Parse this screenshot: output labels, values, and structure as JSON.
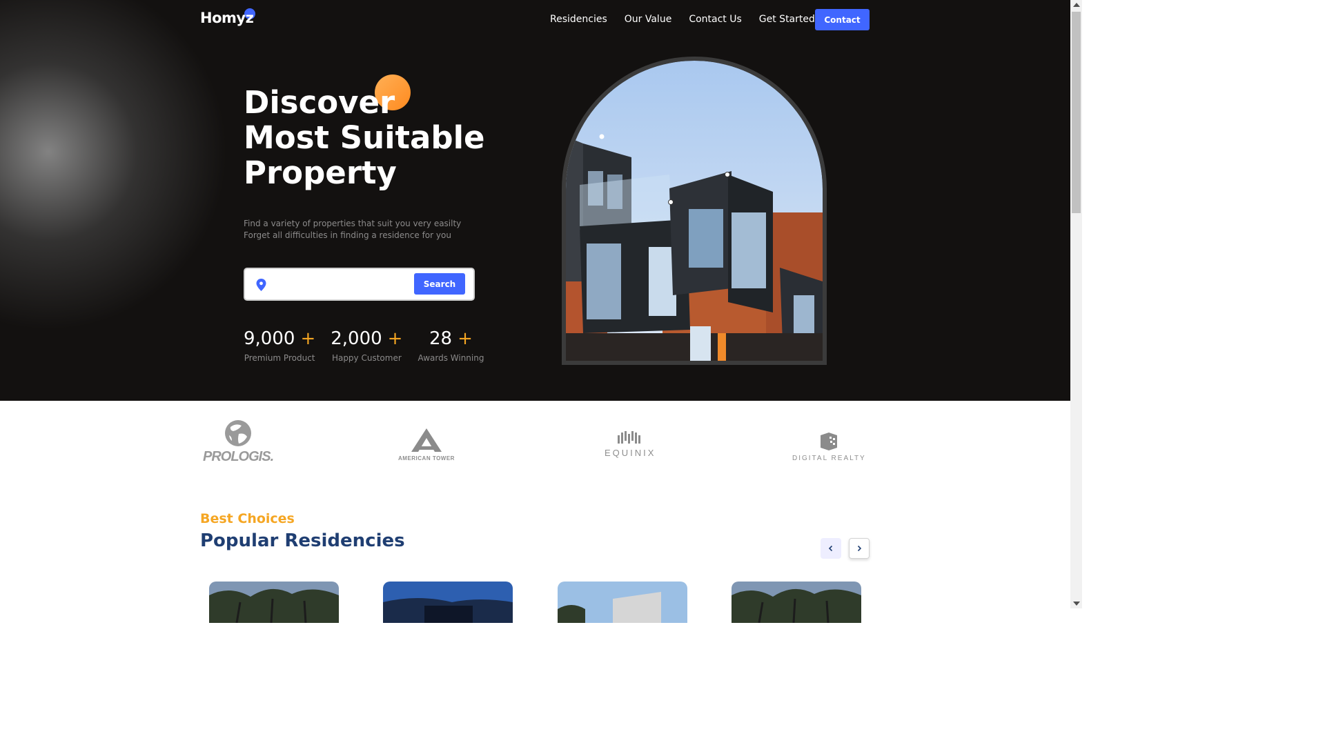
{
  "brand": {
    "name": "Homyz",
    "accent": "#4066ff",
    "orange": "#f5a623"
  },
  "nav": {
    "items": [
      "Residencies",
      "Our Value",
      "Contact Us",
      "Get Started"
    ],
    "contact_label": "Contact"
  },
  "hero": {
    "title_lines": [
      "Discover",
      "Most Suitable",
      "Property"
    ],
    "subtitle_lines": [
      "Find a variety of properties that suit you very easilty",
      "Forget all difficulties in finding a residence for you"
    ],
    "search": {
      "value": "",
      "button_label": "Search"
    },
    "stats": [
      {
        "value": "9,000",
        "plus": "+",
        "label": "Premium Product"
      },
      {
        "value": "2,000",
        "plus": "+",
        "label": "Happy Customer"
      },
      {
        "value": "28",
        "plus": "+",
        "label": "Awards Winning"
      }
    ]
  },
  "companies": {
    "prologis": "PROLOGIS.",
    "american_tower": "AMERICAN TOWER",
    "equinix": "EQUINIX",
    "digital_realty": "DIGITAL REALTY"
  },
  "residencies": {
    "eyebrow": "Best Choices",
    "title": "Popular Residencies",
    "prev_icon": "chevron-left-icon",
    "next_icon": "chevron-right-icon"
  }
}
